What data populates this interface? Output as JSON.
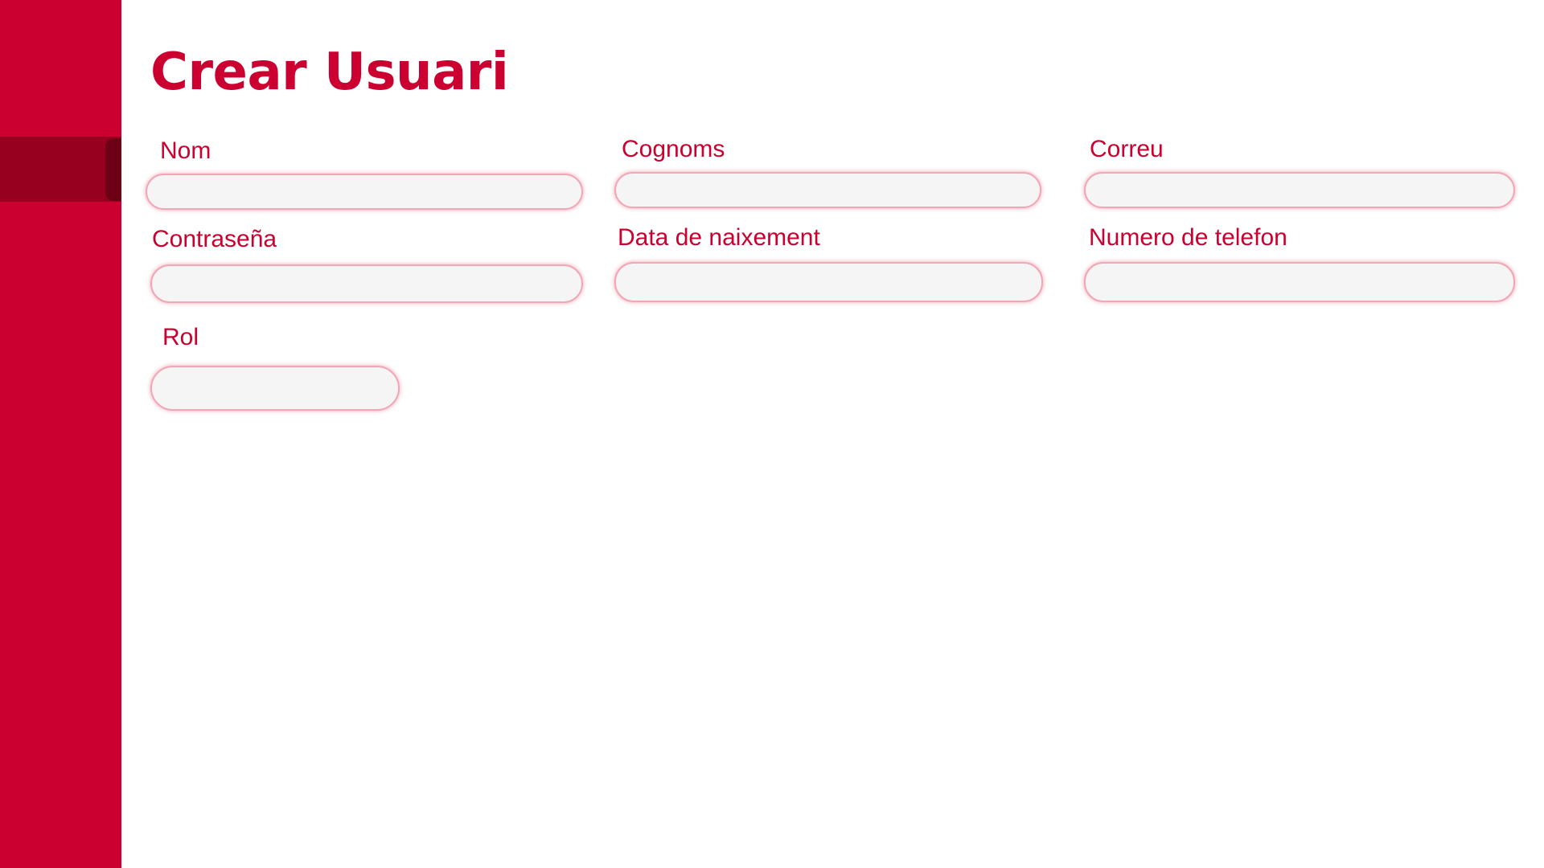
{
  "page": {
    "title": "Crear Usuari"
  },
  "form": {
    "nom": {
      "label": "Nom",
      "value": ""
    },
    "cognoms": {
      "label": "Cognoms",
      "value": ""
    },
    "correu": {
      "label": "Correu",
      "value": ""
    },
    "contrasena": {
      "label": "Contraseña",
      "value": ""
    },
    "data_naixement": {
      "label": "Data de naixement",
      "value": ""
    },
    "telefon": {
      "label": "Numero de telefon",
      "value": ""
    },
    "rol": {
      "label": "Rol",
      "value": ""
    }
  },
  "colors": {
    "accent": "#cc0030",
    "sidebar_active": "#98001f",
    "input_background": "#f5f5f5",
    "input_border": "#f2a6b6"
  }
}
